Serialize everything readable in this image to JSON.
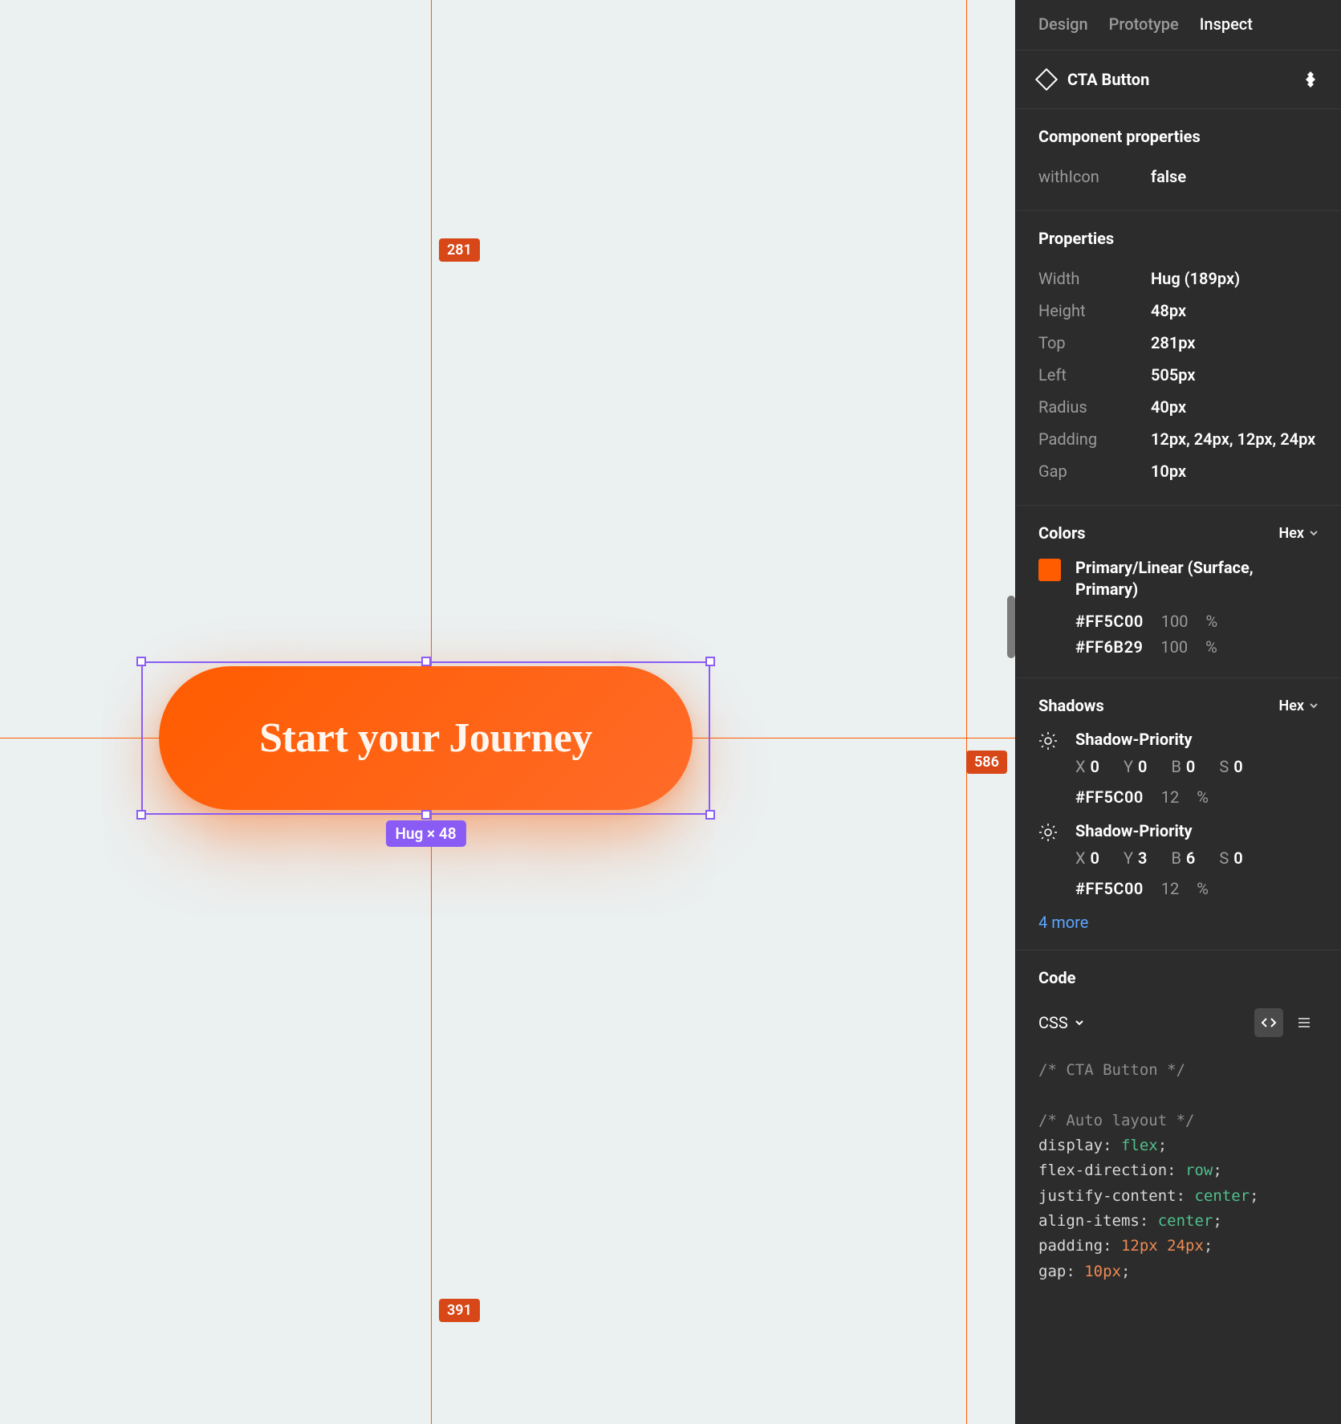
{
  "canvas": {
    "button_text": "Start your Journey",
    "dist_top": "281",
    "dist_right": "586",
    "dist_bottom": "391",
    "sel_size": "Hug × 48"
  },
  "panel": {
    "tabs": {
      "design": "Design",
      "prototype": "Prototype",
      "inspect": "Inspect"
    },
    "element_name": "CTA Button",
    "component_props": {
      "title": "Component properties",
      "rows": [
        {
          "k": "withIcon",
          "v": "false"
        }
      ]
    },
    "properties": {
      "title": "Properties",
      "rows": [
        {
          "k": "Width",
          "v": "Hug (189px)"
        },
        {
          "k": "Height",
          "v": "48px"
        },
        {
          "k": "Top",
          "v": "281px"
        },
        {
          "k": "Left",
          "v": "505px"
        },
        {
          "k": "Radius",
          "v": "40px"
        },
        {
          "k": "Padding",
          "v": "12px, 24px, 12px, 24px"
        },
        {
          "k": "Gap",
          "v": "10px"
        }
      ]
    },
    "colors": {
      "title": "Colors",
      "format": "Hex",
      "swatch_name": "Primary/Linear (Surface, Primary)",
      "stops": [
        {
          "hex": "#FF5C00",
          "opacity": "100",
          "unit": "%"
        },
        {
          "hex": "#FF6B29",
          "opacity": "100",
          "unit": "%"
        }
      ]
    },
    "shadows": {
      "title": "Shadows",
      "format": "Hex",
      "items": [
        {
          "name": "Shadow-Priority",
          "x": "0",
          "y": "0",
          "b": "0",
          "s": "0",
          "hex": "#FF5C00",
          "op": "12",
          "unit": "%"
        },
        {
          "name": "Shadow-Priority",
          "x": "0",
          "y": "3",
          "b": "6",
          "s": "0",
          "hex": "#FF5C00",
          "op": "12",
          "unit": "%"
        }
      ],
      "more": "4 more"
    },
    "code": {
      "title": "Code",
      "lang": "CSS",
      "c1": "/* CTA Button */",
      "c2": "/* Auto layout */",
      "lines": [
        {
          "p": "display",
          "v": "flex",
          "kw": true
        },
        {
          "p": "flex-direction",
          "v": "row",
          "kw": true
        },
        {
          "p": "justify-content",
          "v": "center",
          "kw": true
        },
        {
          "p": "align-items",
          "v": "center",
          "kw": true
        },
        {
          "p": "padding",
          "v": "12px 24px",
          "kw": false
        },
        {
          "p": "gap",
          "v": "10px",
          "kw": false
        }
      ]
    }
  }
}
